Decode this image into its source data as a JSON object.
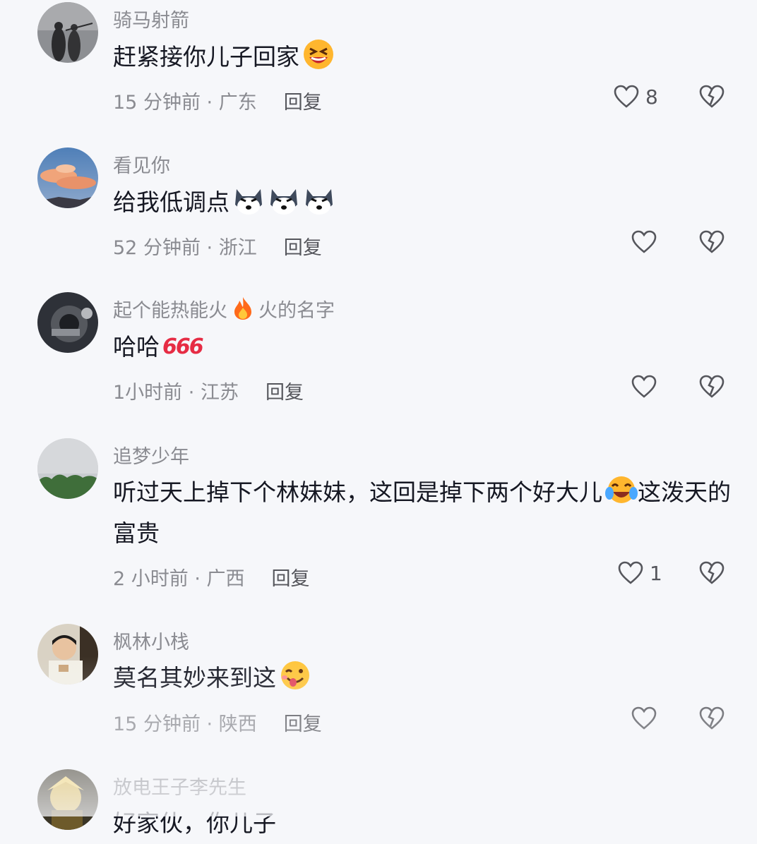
{
  "comments": [
    {
      "username": "骑马射箭",
      "text": "赶紧接你儿子回家",
      "emoji": "laughing-squint-emoji",
      "time": "15 分钟前",
      "location": "广东",
      "reply": "回复",
      "likes": "8"
    },
    {
      "username": "看见你",
      "text": "给我低调点",
      "emoji": "husky-face-emoji",
      "time": "52 分钟前",
      "location": "浙江",
      "reply": "回复",
      "likes": ""
    },
    {
      "username_part1": "起个能热能火",
      "username_part2": "火的名字",
      "username_icon": "fire-emoji",
      "text": "哈哈",
      "badge": "666",
      "time": "1小时前",
      "location": "江苏",
      "reply": "回复",
      "likes": ""
    },
    {
      "username": "追梦少年",
      "text_part1": "听过天上掉下个林妹妹，这回是掉下两个好大儿",
      "text_part2": "这泼天的富贵",
      "emoji": "tears-of-joy-emoji",
      "time": "2 小时前",
      "location": "广西",
      "reply": "回复",
      "likes": "1"
    },
    {
      "username": "枫林小栈",
      "text": "莫名其妙来到这",
      "emoji": "tongue-wink-emoji",
      "time": "15 分钟前",
      "location": "陕西",
      "reply": "回复",
      "likes": ""
    },
    {
      "username": "放电王子李先生",
      "text": "好家伙，你儿子"
    }
  ],
  "separator": "·",
  "colors": {
    "background": "#f6f7fa",
    "text": "#161823",
    "muted": "#8a8b91",
    "icon": "#55565c",
    "accent_red": "#e62c44"
  }
}
